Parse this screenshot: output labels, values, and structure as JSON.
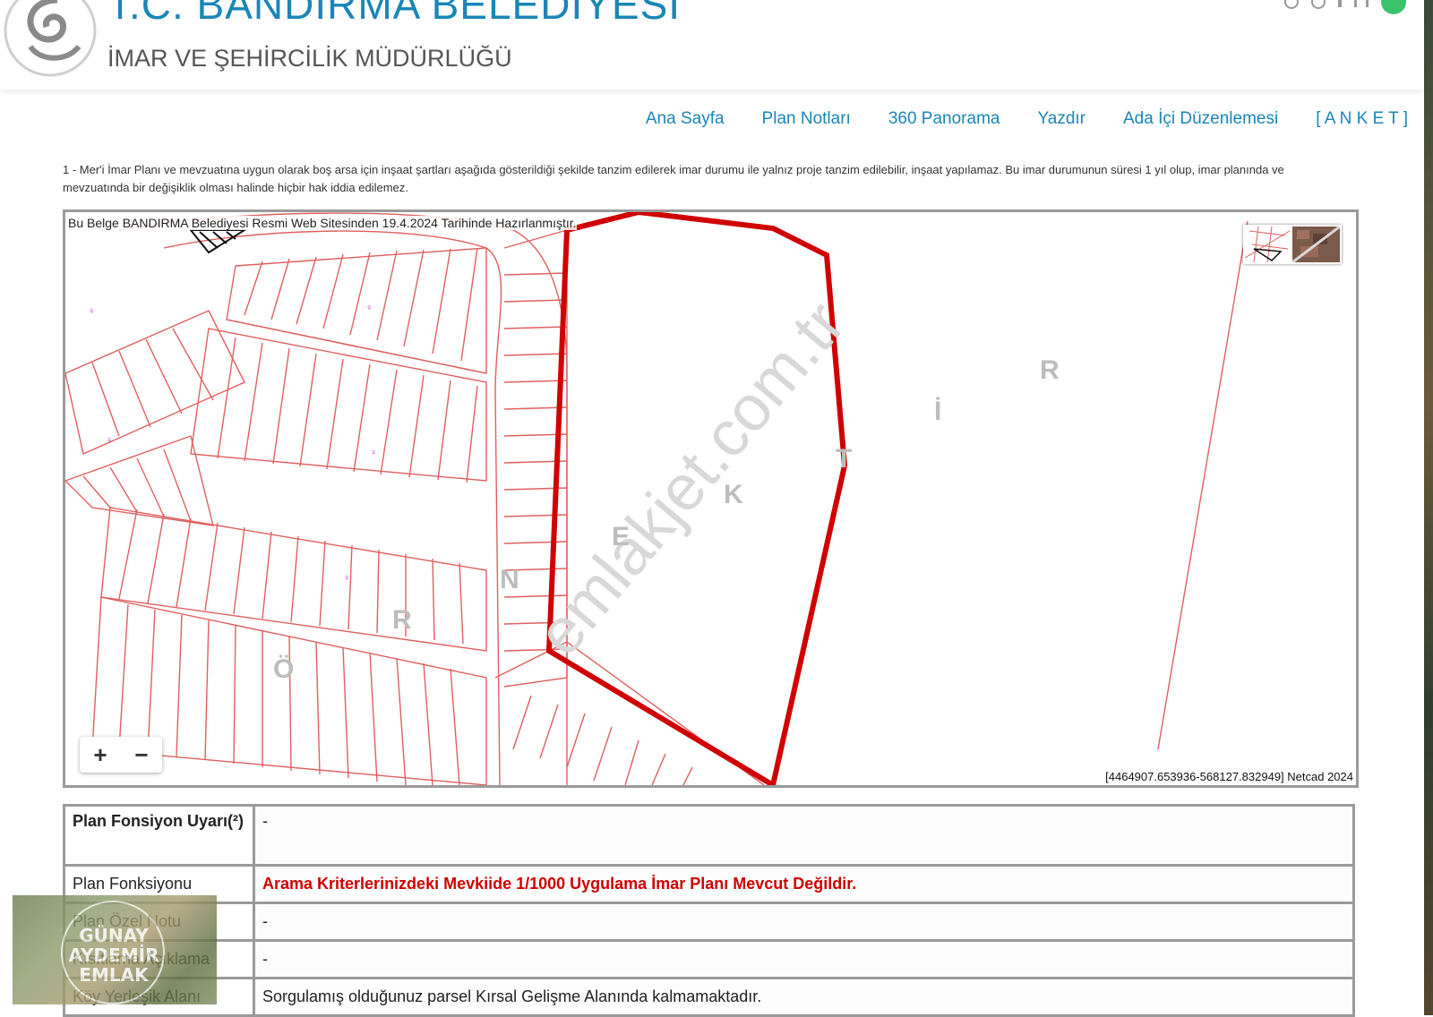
{
  "header": {
    "title": "T.C. BANDIRMA BELEDİYESİ",
    "subtitle": "İMAR VE ŞEHİRCİLİK MÜDÜRLÜĞÜ"
  },
  "nav": {
    "items": [
      "Ana Sayfa",
      "Plan Notları",
      "360 Panorama",
      "Yazdır",
      "Ada İçi Düzenlemesi",
      "[ A N K E T ]"
    ]
  },
  "notice": "1 - Mer'i İmar Planı ve mevzuatına uygun olarak boş arsa için inşaat şartları aşağıda gösterildiği şekilde tanzim edilerek imar durumu ile yalnız proje tanzim edilebilir, inşaat yapılamaz. Bu imar durumunun süresi 1 yıl olup, imar planında ve mevzuatında bir değişiklik olması halinde hiçbir hak iddia edilemez.",
  "map": {
    "header_text": "Bu Belge BANDIRMA Belediyesi Resmi Web Sitesinden 19.4.2024 Tarihinde Hazırlanmıştır.",
    "zoom_in": "+",
    "zoom_out": "−",
    "coords": "[4464907.653936-568127.832949] Netcad 2024",
    "letters": [
      "Ö",
      "R",
      "N",
      "E",
      "K",
      "T",
      "İ",
      "R"
    ],
    "watermark": "emlakjet.com.tr"
  },
  "table": {
    "rows": [
      {
        "label": "Plan Fonsiyon Uyarı(²)",
        "value": "-"
      },
      {
        "label": "Plan Fonksiyonu",
        "value": "Arama Kriterlerinizdeki Mevkiide 1/1000 Uygulama İmar Planı Mevcut Değildir."
      },
      {
        "label": "Plan Özel Notu",
        "value": "-"
      },
      {
        "label": "Kısıtlama Açıklama",
        "value": "-"
      },
      {
        "label": "Köy Yerleşik Alanı",
        "value": "Sorgulamış olduğunuz parsel Kırsal Gelişme Alanında kalmamaktadır."
      }
    ]
  },
  "badge": {
    "line1": "GÜNAY",
    "line2": "AYDEMİR",
    "line3": "EMLAK"
  },
  "colors": {
    "brand": "#1a86b8",
    "parcel_line": "#e05050",
    "boundary": "#d00000"
  }
}
